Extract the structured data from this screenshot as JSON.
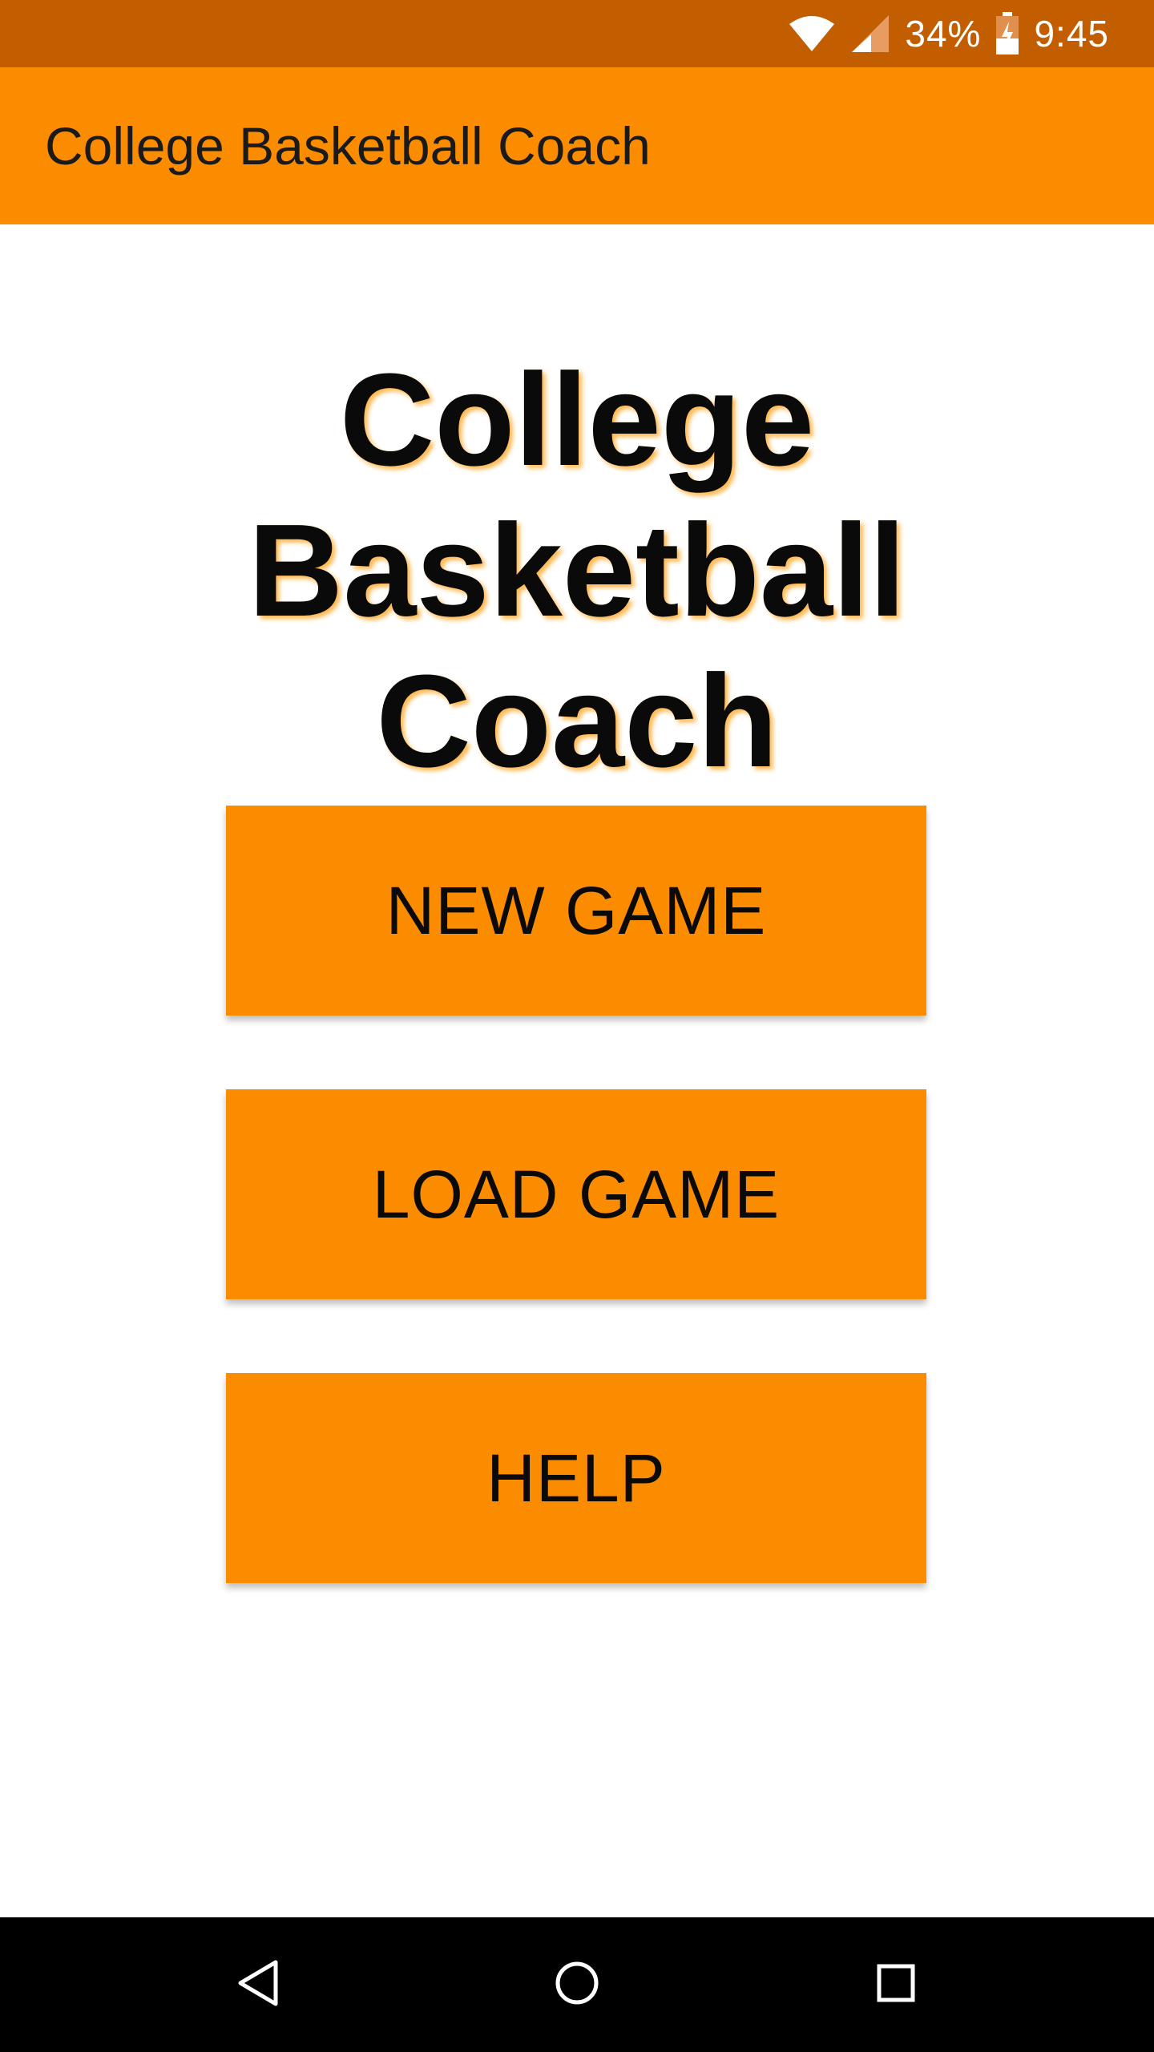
{
  "status_bar": {
    "battery_percent": "34%",
    "time": "9:45",
    "icons": [
      "wifi-icon",
      "cell-signal-icon",
      "battery-charging-icon"
    ]
  },
  "app_bar": {
    "title": "College Basketball Coach"
  },
  "main": {
    "headline_line1": "College Basketball",
    "headline_line2": "Coach",
    "buttons": {
      "new_game": "NEW GAME",
      "load_game": "LOAD GAME",
      "help": "HELP"
    }
  },
  "nav_bar": {
    "icons": [
      "back-icon",
      "home-icon",
      "recents-icon"
    ]
  },
  "colors": {
    "status_bar": "#c25e00",
    "accent": "#fb8c00",
    "text": "#0a0a0a",
    "nav_bar": "#000000"
  }
}
